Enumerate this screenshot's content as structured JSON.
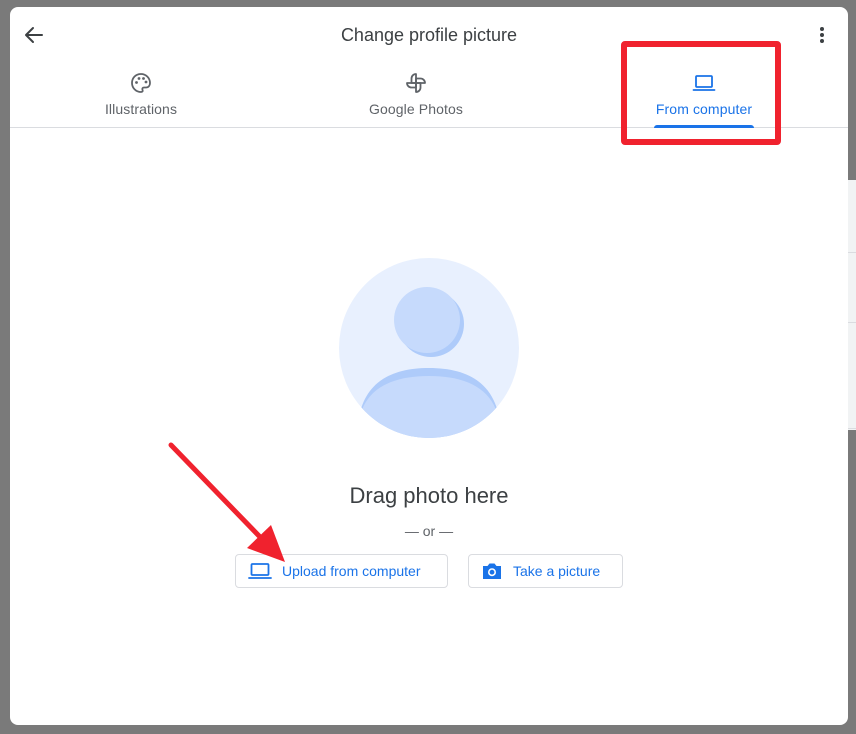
{
  "dialog": {
    "title": "Change profile picture"
  },
  "tabs": [
    {
      "label": "Illustrations",
      "icon": "palette-icon",
      "active": false
    },
    {
      "label": "Google Photos",
      "icon": "pinwheel-icon",
      "active": false
    },
    {
      "label": "From computer",
      "icon": "laptop-icon",
      "active": true
    }
  ],
  "main": {
    "drag_text": "Drag photo here",
    "or_text": "— or —",
    "upload_label": "Upload from computer",
    "take_picture_label": "Take a picture"
  },
  "colors": {
    "accent": "#1a73e8",
    "annotation_red": "#f0222e",
    "avatar_bg": "#e8f0fe"
  }
}
